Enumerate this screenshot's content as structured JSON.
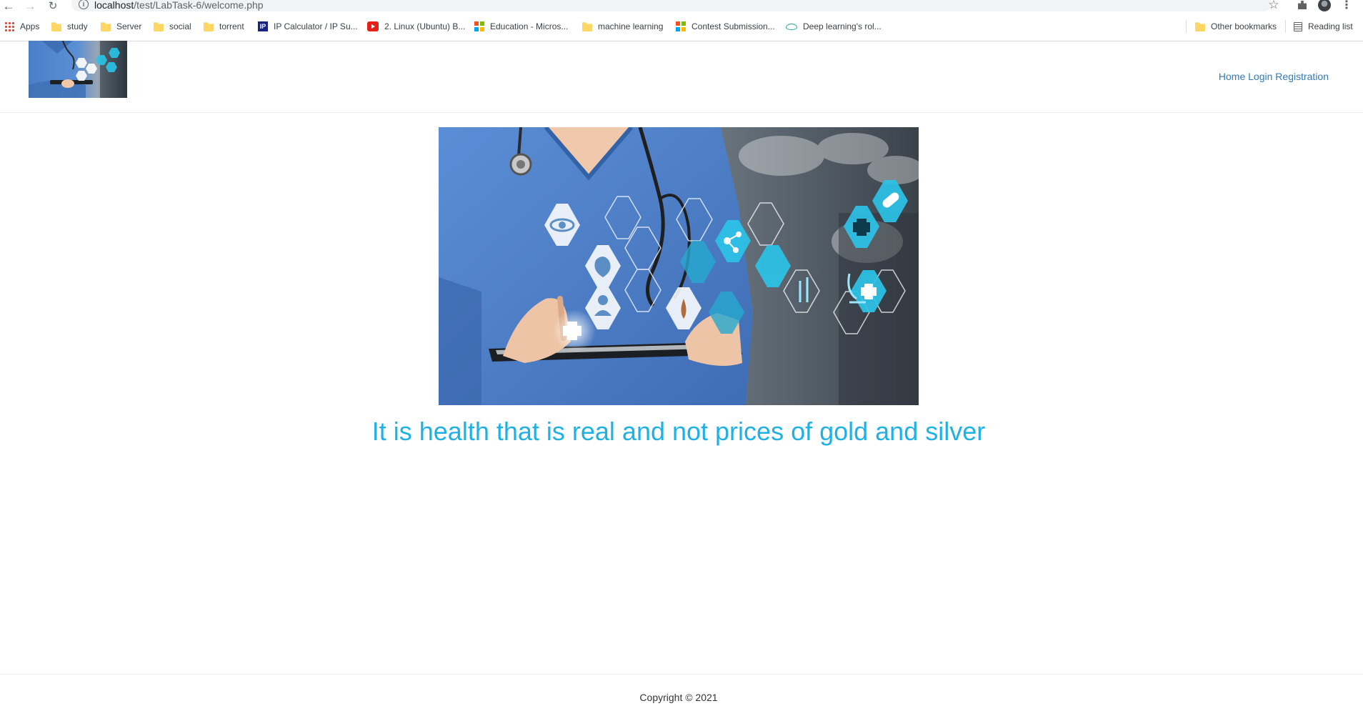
{
  "browser": {
    "url_host": "localhost",
    "url_path": "/test/LabTask-6/welcome.php",
    "nav_icons": {
      "back": "arrow-left-icon",
      "forward": "arrow-right-icon",
      "reload": "reload-icon"
    },
    "bookmarks": [
      {
        "label": "Apps",
        "icon": "apps-grid-icon"
      },
      {
        "label": "study",
        "icon": "folder-icon"
      },
      {
        "label": "Server",
        "icon": "folder-icon"
      },
      {
        "label": "social",
        "icon": "folder-icon"
      },
      {
        "label": "torrent",
        "icon": "folder-icon"
      },
      {
        "label": "IP Calculator / IP Su...",
        "icon": "ip-icon"
      },
      {
        "label": "2. Linux (Ubuntu) B...",
        "icon": "youtube-icon"
      },
      {
        "label": "Education - Micros...",
        "icon": "microsoft-icon"
      },
      {
        "label": "machine learning",
        "icon": "folder-icon"
      },
      {
        "label": "Contest Submission...",
        "icon": "microsoft-icon"
      },
      {
        "label": "Deep learning's rol...",
        "icon": "eye-icon"
      }
    ],
    "other_bookmarks": "Other bookmarks",
    "reading_list": "Reading list"
  },
  "header": {
    "logo_icon": "doctor-tablet-logo",
    "nav": {
      "home": "Home",
      "login": "Login",
      "registration": "Registration"
    }
  },
  "hero": {
    "image_icon": "doctor-medical-icons-image",
    "tagline": "It is health that is real and not prices of gold and silver"
  },
  "footer": {
    "copyright": "Copyright © 2021"
  },
  "colors": {
    "accent": "#1fb1e6",
    "link": "#337ab7",
    "scrubs": "#4a7fc8"
  }
}
